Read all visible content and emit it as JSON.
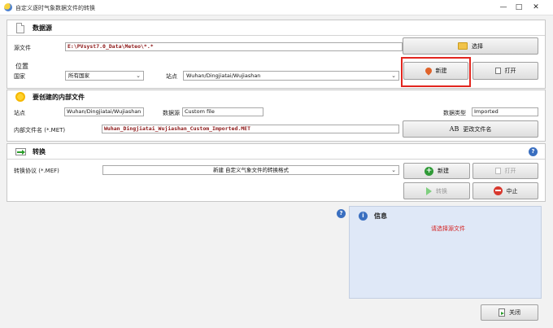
{
  "window": {
    "title": "自定义逐时气象数据文件的转换",
    "minimize": "—",
    "maximize": "□",
    "close": "✕"
  },
  "source": {
    "title": "数据源",
    "file_label": "源文件",
    "file_value": "E:\\PVsyst7.0_Data\\Meteo\\*.*",
    "choose_button": "选择",
    "location_label": "位置",
    "country_label": "国家",
    "country_value": "所有国家",
    "site_label": "站点",
    "site_value": "Wuhan/Dingjiatai/Wujiashan",
    "new_button": "新建",
    "open_button": "打开"
  },
  "internal": {
    "title": "要创建的内部文件",
    "site_label": "站点",
    "site_value": "Wuhan/Dingjiatai/Wujiashan",
    "source_label": "数据源",
    "source_value": "Custom file",
    "type_label": "数据类型",
    "type_value": "Imported",
    "filename_label": "内部文件名 (*.MET)",
    "filename_value": "Wuhan_Dingjiatai_Wujiashan_Custom_Imported.MET",
    "rename_button": "更改文件名",
    "rename_glyph": "AB"
  },
  "convert": {
    "title": "转换",
    "protocol_label": "转换协议 (*.MEF)",
    "protocol_value": "新建 自定义气象文件的转换格式",
    "new_button": "新建",
    "open_button": "打开",
    "convert_button": "转换",
    "abort_button": "中止"
  },
  "info": {
    "title": "信息",
    "message": "请选择源文件",
    "help": "?",
    "i": "i"
  },
  "close_button": "关闭"
}
